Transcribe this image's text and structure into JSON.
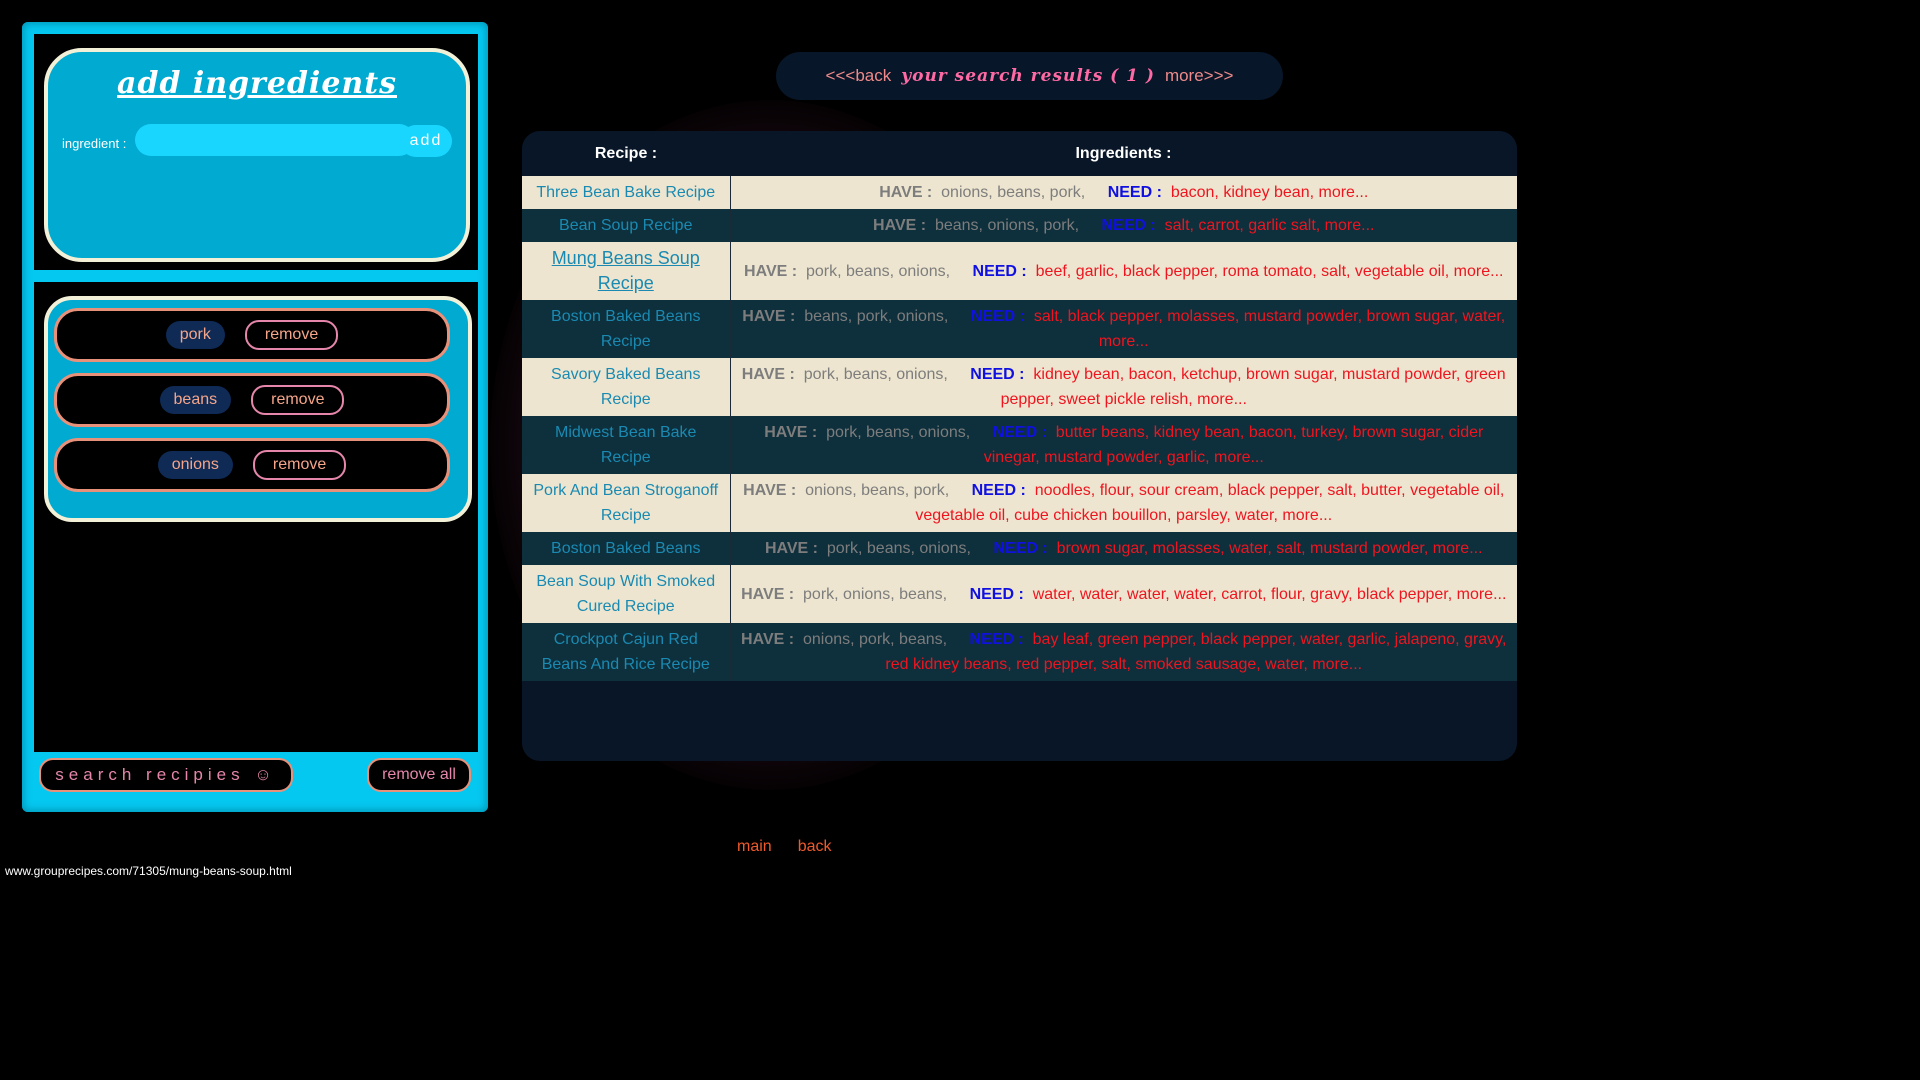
{
  "sidebar": {
    "title": "add ingredients",
    "ingredient_label": "ingredient :",
    "ingredient_value": "",
    "add_label": "add",
    "ingredients": [
      {
        "name": "pork",
        "remove": "remove"
      },
      {
        "name": "beans",
        "remove": "remove"
      },
      {
        "name": "onions",
        "remove": "remove"
      }
    ],
    "search_label": "search recipies ☺",
    "remove_all_label": "remove all"
  },
  "results": {
    "back_label": "<<<back",
    "title": "your search results ( 1 )",
    "more_label": "more>>>",
    "header_recipe": "Recipe :",
    "header_ingredients": "Ingredients :",
    "have_label": "HAVE :",
    "need_label": "NEED :",
    "rows": [
      {
        "recipe": "Three Bean Bake Recipe",
        "have": "onions, beans, pork,",
        "need": "bacon, kidney bean, more..."
      },
      {
        "recipe": "Bean Soup Recipe",
        "have": "beans, onions, pork,",
        "need": "salt, carrot, garlic salt, more..."
      },
      {
        "recipe": "Mung Beans Soup Recipe",
        "have": "pork, beans, onions,",
        "need": "beef, garlic, black pepper, roma tomato, salt, vegetable oil, more..."
      },
      {
        "recipe": "Boston Baked Beans Recipe",
        "have": "beans, pork, onions,",
        "need": "salt, black pepper, molasses, mustard powder, brown sugar, water, more..."
      },
      {
        "recipe": "Savory Baked Beans Recipe",
        "have": "pork, beans, onions,",
        "need": "kidney bean, bacon, ketchup, brown sugar, mustard powder, green pepper, sweet pickle relish, more..."
      },
      {
        "recipe": "Midwest Bean Bake Recipe",
        "have": "pork, beans, onions,",
        "need": "butter beans, kidney bean, bacon, turkey, brown sugar, cider vinegar, mustard powder, garlic, more..."
      },
      {
        "recipe": "Pork And Bean Stroganoff Recipe",
        "have": "onions, beans, pork,",
        "need": "noodles, flour, sour cream, black pepper, salt, butter, vegetable oil, vegetable oil, cube chicken bouillon, parsley, water, more..."
      },
      {
        "recipe": "Boston Baked Beans",
        "have": "pork, beans, onions,",
        "need": "brown sugar, molasses, water, salt, mustard powder, more..."
      },
      {
        "recipe": "Bean Soup With Smoked Cured Recipe",
        "have": "pork, onions, beans,",
        "need": "water, water, water, water, carrot, flour, gravy, black pepper, more..."
      },
      {
        "recipe": "Crockpot Cajun Red Beans And Rice Recipe",
        "have": "onions, pork, beans,",
        "need": "bay leaf, green pepper, black pepper, water, garlic, jalapeno, gravy, red kidney beans, red pepper, salt, smoked sausage, water, more..."
      }
    ]
  },
  "footer": {
    "main_label": "main",
    "back_label": "back"
  },
  "status_url": "www.grouprecipes.com/71305/mung-beans-soup.html"
}
